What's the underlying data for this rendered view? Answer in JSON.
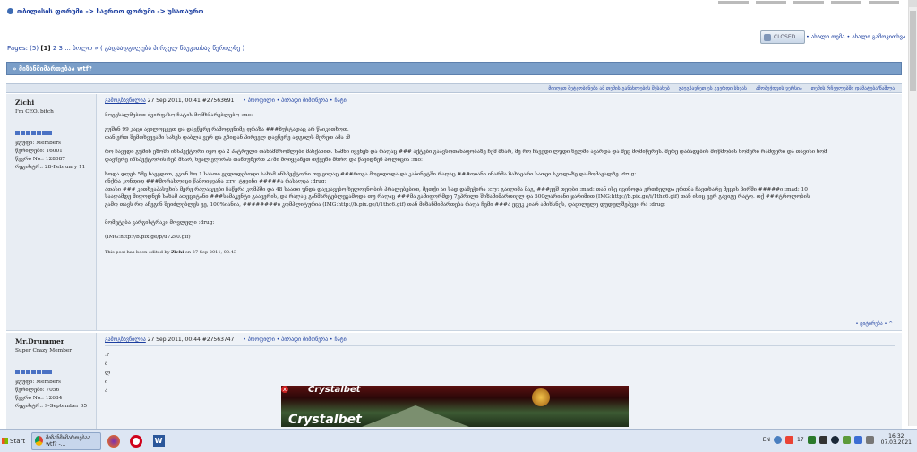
{
  "breadcrumb": "თბილისის ფორუმი -> საერთო ფორუმი -> უსათაურო",
  "thread": {
    "closed_label": "CLOSED",
    "new_links": "• ახალი თემა • ახალი გამოკითხვა",
    "pages_prefix": "Pages: (5)",
    "current_page": "[1]",
    "other_pages": "2 3 ... ბოლო »",
    "jump_text": "( გადაადგილება პირველ წაუკითხავ წერილზე )",
    "title": "» მიზანმიმართებაა wtf?",
    "options": [
      "მიიღეთ შეტყობინება ამ თემის განახლების შესახებ",
      "გაუგზავნეთ ეს გვერდი სხვას",
      "ამობეჭდვის ვერსია",
      "თემის რჩეულებში დამატება/წაშლა"
    ]
  },
  "posts": [
    {
      "username": "Zichi",
      "user_title": "I'm CEO. bitch",
      "group": "ჯგუფი: Members",
      "posts_count": "წერილები: 16001",
      "member_no": "წევრი No.: 128087",
      "registered": "რეგისტრ.: 28-February 11",
      "date_link": "გამოგზავნილია",
      "date": "27 Sep 2011, 00:41",
      "post_id": "#27563691",
      "actions": "• პროფილი • პირადი მიმოწერა • ჩატი",
      "paragraphs": [
        "მოგესალმებით ძვირფასო ჩატის მომხმარებლებო :mo:",
        "გუშინ 99 კაცი ავილოცვეთ და დავწერე რამოდენიმე ფრაზა ###ზუსტადაც არ წაიკითხოთ.\nთან ერთ შემთხვევაში სახეს დაბლა ვერ და გზიდან პირველ დავწერე ადგილს მერეთ ამა :შ",
        "რო ჩავედი გუშინ ეზოში ინსპექტორი იყო და 2 პატრული თანამშრომლები მანქანით. სამნი იყვნენ და რაღაც ### აქტები გაავსოთანაფობაზე ჩემ მხარ, მე რო ჩავედი ლუდი ხელში ავარდა და მეც მომიწერეს. მერე დაბადების მოწმობის ნომერი რამფერი და თავისი ნომ\nდავწერე ინსპექტორის ჩემ მხარ, ხვალ ეღირას თანხუნერთ 27მი მოიყვანეთ თქვენი მხრო და წავიდნენ პოლიცია :mo:",
        "ხოდა დღეს 5შე ჩავედით, ეკონ ხო 1 საათი ველოდებოდი სახამ ინსპექტორი თუ ვიღაც ###როგა მოვიდოდა და კაბინეტში რაღაც ###ოიანი ინარმა ზახავარი სათეი სკოლაზე და მომავალზე :drug:\nინქრა კონდიდ ###მორასლიცი წამოიყვანა :cry: ტყვინი #####ა რასაღცა :drug:\nათასი ### კითხვაპასუხის მერე რაღაცეები ჩაწერა კომპში და 48 საათი უნდა დავკავებო ხელოვნობის პრალებებით, მეთქი აი სად დამეჭირა :cry: გაიღიმა მაგ, ###ეეშ თეობი :mad: თან ისე იცინოდა ერთხელდა ერთმა ჩავთხარე მეცის პირში #####ი :mad: 10\nსააღამდე მიღოდნენ სახამ ათეციტანი ###სამაკენტი გაავერის, და რაღაც განმარტებლეგამოდა თუ რაღაც ###მა გამიფორმდე 7ეპრილი შიზამიმართიელ და 500ლარიანი ჯარიმით (IMG:http://b.pix.ge/i/1thc6.gif) თან ისიც ვერ გავიგე რატო. თქ ###ტროლობის\nგამო თავს რო აჩეგინ შეიძლებლეს ეე, 100%იანია, ########ი კომპლიტურია (IMG:http://b.pix.ge/i/1thc6.gif) თან მიზანმიმართება რაღა ჩემი ###ა ეცეკ კიარ ამიხსნეს, დაცილელე დუდულშეპვეი რა :drug:",
        "მომეტება კარგისტრაკი მოვლელი :drug:",
        "(IMG:http://b.pix.ge/p/u72s0.gif)"
      ],
      "edited_prefix": "This post has been edited by",
      "edited_by": "Zichi",
      "edited_suffix": "on 27 Sep 2011, 00:43",
      "footer": "• ციტირება • ^"
    },
    {
      "username": "Mr.Drummer",
      "user_title": "Super Crazy Member",
      "group": "ჯგუფი: Members",
      "posts_count": "წერილები: 7056",
      "member_no": "წევრი No.: 12684",
      "registered": "რეგისტრ.: 9-September 05",
      "date_link": "გამოგზავნილია",
      "date": "27 Sep 2011, 00:44",
      "post_id": "#27563747",
      "actions": "• პროფილი • პირადი მიმოწერა • ჩატი",
      "lines": [
        ":?",
        "ბ",
        "ლ",
        "ი",
        "ა"
      ]
    }
  ],
  "ad": {
    "brand": "Crystalbet",
    "close": "x"
  },
  "taskbar": {
    "start": "Start",
    "chrome_tab": "მიზანმიმართებაა wtf? -...",
    "lang": "EN",
    "tray_count": "17",
    "time": "16:32",
    "date": "07.03.2021"
  },
  "colors": {
    "header": "#7a9ec8",
    "post_bg": "#eef2f7",
    "link": "#1c3fa0"
  }
}
